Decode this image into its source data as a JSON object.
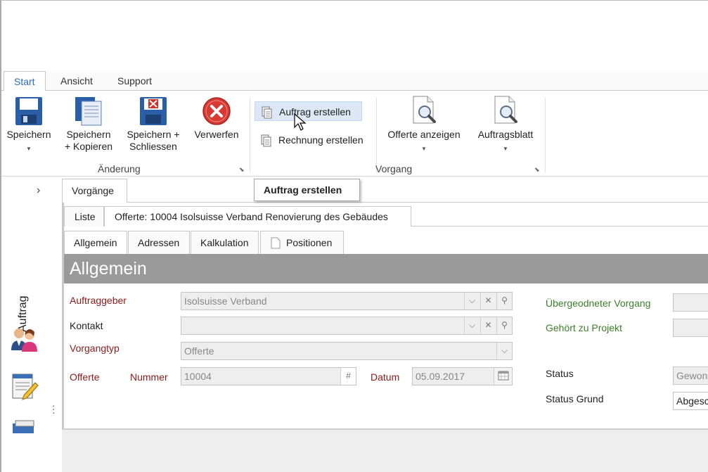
{
  "ribbon_tabs": [
    "Start",
    "Ansicht",
    "Support"
  ],
  "ribbon": {
    "save": "Speichern",
    "save_copy_1": "Speichern",
    "save_copy_2": "+ Kopieren",
    "save_close_1": "Speichern +",
    "save_close_2": "Schliessen",
    "discard": "Verwerfen",
    "group_change": "Änderung",
    "create_order": "Auftrag erstellen",
    "create_invoice": "Rechnung erstellen",
    "show_offer": "Offerte anzeigen",
    "order_sheet": "Auftragsblatt",
    "group_process": "Vorgang"
  },
  "tooltip": "Auftrag erstellen",
  "rail": {
    "label": "Auftrag"
  },
  "tabs_level1": [
    "Vorgänge"
  ],
  "tabs_level2": [
    "Liste",
    "Offerte: 10004 Isolsuisse Verband Renovierung des Gebäudes"
  ],
  "tabs_level3": [
    "Allgemein",
    "Adressen",
    "Kalkulation",
    "Positionen"
  ],
  "section_title": "Allgemein",
  "form": {
    "client_label": "Auftraggeber",
    "client_value": "Isolsuisse Verband",
    "contact_label": "Kontakt",
    "contact_value": "",
    "type_label": "Vorgangtyp",
    "type_value": "Offerte",
    "offer_label": "Offerte",
    "number_label": "Nummer",
    "number_value": "10004",
    "date_label": "Datum",
    "date_value": "05.09.2017",
    "parent_label": "Übergeodneter Vorgang",
    "project_label": "Gehört zu Projekt",
    "status_label": "Status",
    "status_value": "Gewonn",
    "status_reason_label": "Status Grund",
    "status_reason_value": "Abgesch"
  },
  "colors": {
    "accent": "#2a6ebb",
    "required": "#8b1a1a",
    "optional": "#3c7f2a",
    "band": "#9a9a9a"
  }
}
